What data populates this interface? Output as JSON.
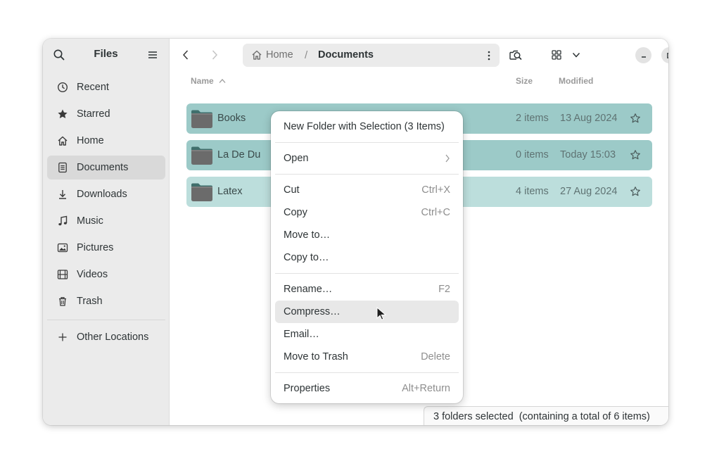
{
  "app": {
    "title": "Files"
  },
  "sidebar": {
    "items": [
      {
        "label": "Recent",
        "icon": "clock-icon",
        "active": false
      },
      {
        "label": "Starred",
        "icon": "star-icon",
        "active": false
      },
      {
        "label": "Home",
        "icon": "home-icon",
        "active": false
      },
      {
        "label": "Documents",
        "icon": "document-icon",
        "active": true
      },
      {
        "label": "Downloads",
        "icon": "download-icon",
        "active": false
      },
      {
        "label": "Music",
        "icon": "music-icon",
        "active": false
      },
      {
        "label": "Pictures",
        "icon": "picture-icon",
        "active": false
      },
      {
        "label": "Videos",
        "icon": "film-icon",
        "active": false
      },
      {
        "label": "Trash",
        "icon": "trash-icon",
        "active": false
      }
    ],
    "other_locations": "Other Locations"
  },
  "path": {
    "home": "Home",
    "separator": "/",
    "current": "Documents"
  },
  "columns": {
    "name": "Name",
    "size": "Size",
    "modified": "Modified"
  },
  "files": [
    {
      "name": "Books",
      "size": "2 items",
      "modified": "13 Aug 2024"
    },
    {
      "name": "La De Du",
      "size": "0 items",
      "modified": "Today 15:03"
    },
    {
      "name": "Latex",
      "size": "4 items",
      "modified": "27 Aug 2024"
    }
  ],
  "context_menu": {
    "new_folder": "New Folder with Selection (3 Items)",
    "open": "Open",
    "cut": {
      "label": "Cut",
      "shortcut": "Ctrl+X"
    },
    "copy": {
      "label": "Copy",
      "shortcut": "Ctrl+C"
    },
    "move_to": "Move to…",
    "copy_to": "Copy to…",
    "rename": {
      "label": "Rename…",
      "shortcut": "F2"
    },
    "compress": "Compress…",
    "email": "Email…",
    "trash": {
      "label": "Move to Trash",
      "shortcut": "Delete"
    },
    "properties": {
      "label": "Properties",
      "shortcut": "Alt+Return"
    }
  },
  "status": "3 folders selected  (containing a total of 6 items)",
  "colors": {
    "selection": "#9ccac8",
    "selection_light": "#bcdedc",
    "sidebar_bg": "#ebebeb",
    "folder": "#6b6b6b"
  }
}
